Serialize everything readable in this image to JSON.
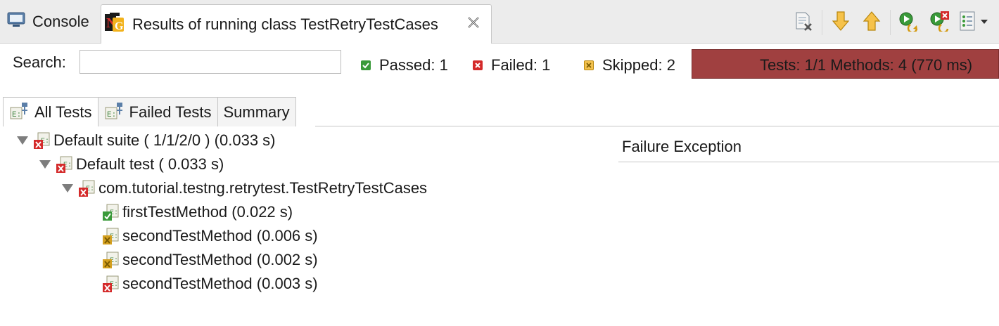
{
  "tabs": {
    "console_label": "Console",
    "results_label": "Results of running class TestRetryTestCases"
  },
  "search": {
    "label": "Search:",
    "value": "",
    "placeholder": ""
  },
  "stats": {
    "passed": "Passed: 1",
    "failed": "Failed: 1",
    "skipped": "Skipped: 2"
  },
  "progress": {
    "text": "Tests: 1/1  Methods: 4 (770 ms)",
    "fraction": 1.0,
    "color": "#a04040"
  },
  "inner_tabs": [
    "All Tests",
    "Failed Tests",
    "Summary"
  ],
  "tree": [
    {
      "label": "Default suite ( 1/1/2/0 ) (0.033 s)",
      "status": "failed",
      "expanded": true
    },
    {
      "label": "Default test ( 0.033 s)",
      "status": "failed",
      "expanded": true
    },
    {
      "label": "com.tutorial.testng.retrytest.TestRetryTestCases",
      "status": "failed",
      "expanded": true
    },
    {
      "label": "firstTestMethod  (0.022 s)",
      "status": "passed"
    },
    {
      "label": "secondTestMethod  (0.006 s)",
      "status": "skipped"
    },
    {
      "label": "secondTestMethod  (0.002 s)",
      "status": "skipped"
    },
    {
      "label": "secondTestMethod  (0.003 s)",
      "status": "failed"
    }
  ],
  "failure_panel": {
    "title": "Failure Exception"
  },
  "colors": {
    "passed": "#3a9a3a",
    "failed": "#d42a2a",
    "skipped": "#d4a020",
    "progress_failed": "#a04040"
  }
}
